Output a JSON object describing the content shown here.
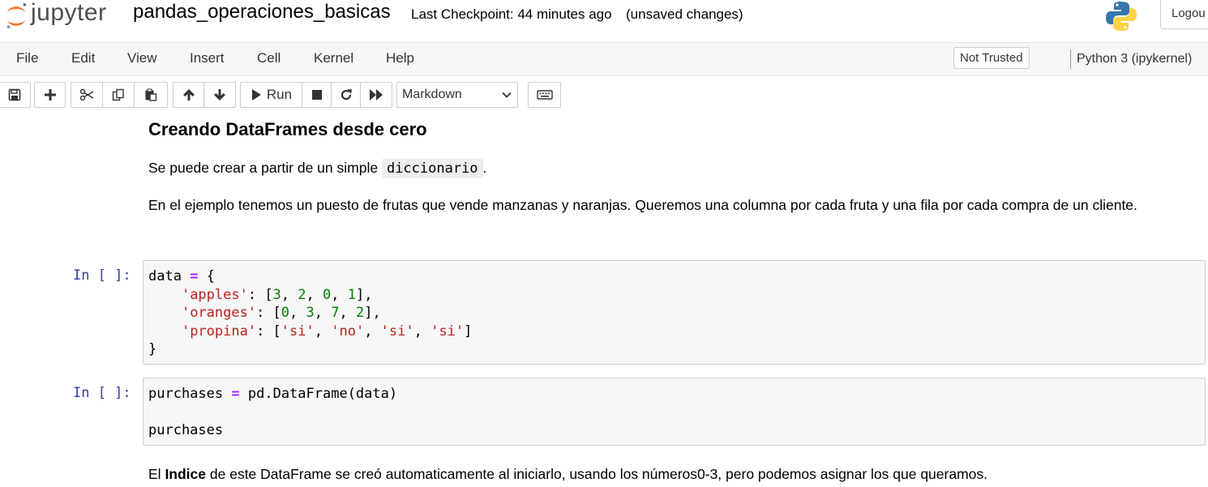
{
  "header": {
    "logo_text": "jupyter",
    "notebook_name": "pandas_operaciones_basicas",
    "checkpoint": "Last Checkpoint: 44 minutes ago",
    "autosave_status": "(unsaved changes)",
    "logout_label": "Logou"
  },
  "menubar": {
    "items": [
      "File",
      "Edit",
      "View",
      "Insert",
      "Cell",
      "Kernel",
      "Help"
    ],
    "trust_status": "Not Trusted",
    "kernel": "Python 3 (ipykernel)"
  },
  "toolbar": {
    "run_label": "Run",
    "cell_type": "Markdown"
  },
  "cells": {
    "heading": "Creando DataFrames desde cero",
    "p1_text": "Se puede crear a partir de un simple ",
    "p1_code": "diccionario",
    "p1_end": ".",
    "p2": "En el ejemplo tenemos un puesto de frutas que vende manzanas y naranjas. Queremos una columna por cada fruta y una fila por cada compra de un cliente.",
    "prompt1": "In [ ]:",
    "code1": {
      "l1_var": "data",
      "l1_op": "=",
      "l1_rest": "{",
      "apples_key": "'apples'",
      "apples_vals": [
        "3",
        "2",
        "0",
        "1"
      ],
      "oranges_key": "'oranges'",
      "oranges_vals": [
        "0",
        "3",
        "7",
        "2"
      ],
      "propina_key": "'propina'",
      "propina_vals": [
        "'si'",
        "'no'",
        "'si'",
        "'si'"
      ],
      "close": "}"
    },
    "prompt2": "In [ ]:",
    "code2": {
      "l1_var": "purchases",
      "l1_op": "=",
      "l1_rest": "pd.DataFrame(data)",
      "l3": "purchases"
    },
    "p3_before": "El ",
    "p3_bold": "Indice",
    "p3_after": " de este DataFrame se creó automaticamente al iniciarlo, usando los números0-3, pero podemos asignar los que queramos."
  }
}
